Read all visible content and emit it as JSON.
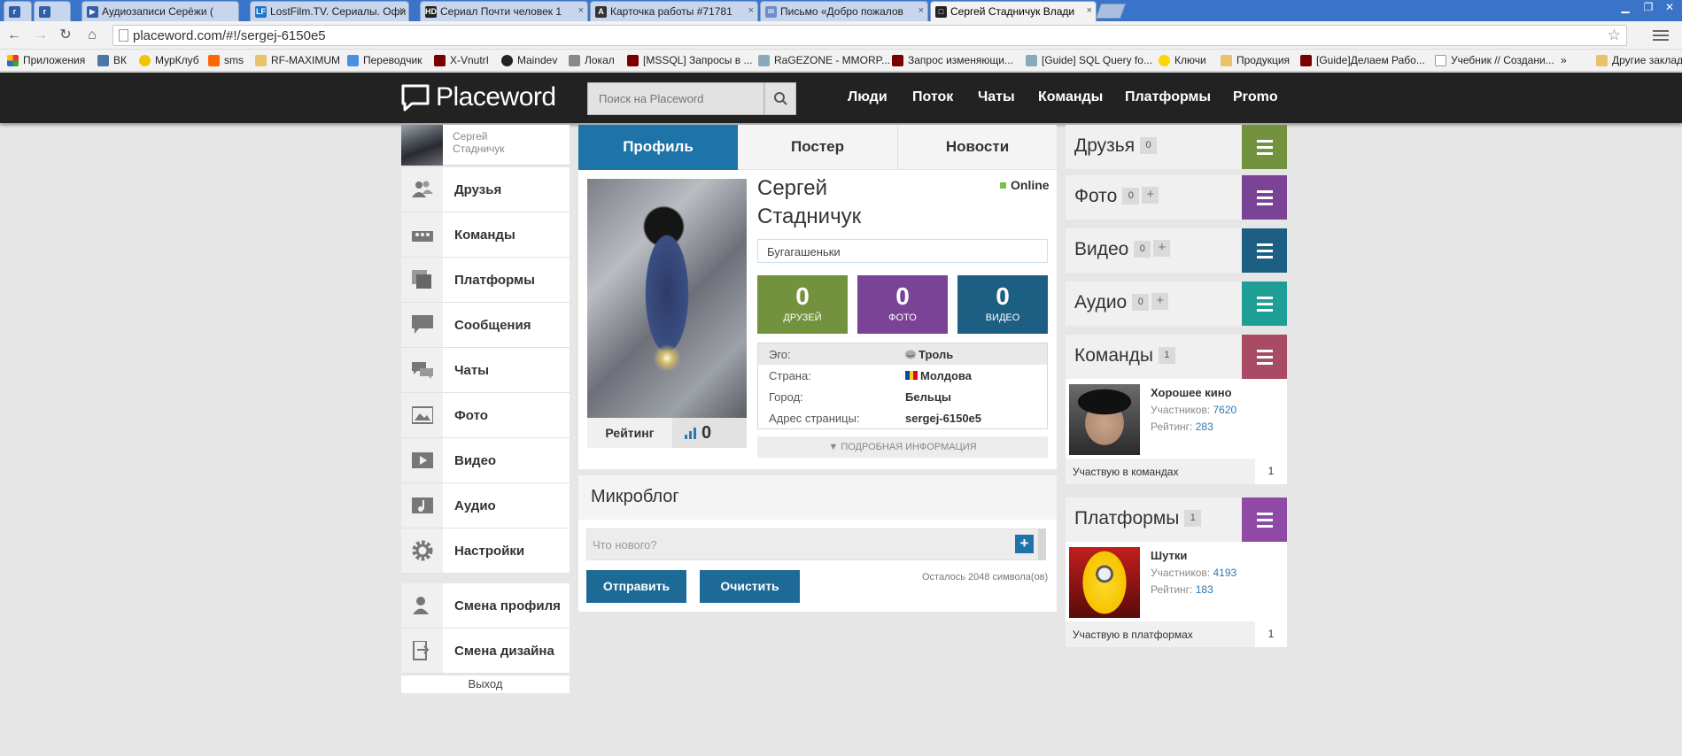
{
  "browser": {
    "tabs": [
      {
        "title": "",
        "favicon": "vk"
      },
      {
        "title": "",
        "favicon": "vk"
      },
      {
        "title": "Аудиозаписи Серёжи (",
        "favicon": "vk-audio"
      },
      {
        "title": "LostFilm.TV. Сериалы. Офи",
        "favicon": "lostfilm"
      },
      {
        "title": "Сериал Почти человек 1",
        "favicon": "hd"
      },
      {
        "title": "Карточка работы #71781",
        "favicon": "a"
      },
      {
        "title": "Письмо «Добро пожалов",
        "favicon": "mail"
      },
      {
        "title": "Сергей Стадничук Влади",
        "favicon": "placeword"
      }
    ],
    "url": "placeword.com/#!/sergej-6150e5",
    "bookmarks": [
      {
        "label": "Приложения",
        "icon": "apps-icon"
      },
      {
        "label": "ВК",
        "icon": "vk-icon"
      },
      {
        "label": "МурКлуб",
        "icon": "cat-icon"
      },
      {
        "label": "sms",
        "icon": "orange-icon"
      },
      {
        "label": "RF-MAXIMUM",
        "icon": "folder-icon"
      },
      {
        "label": "Переводчик",
        "icon": "translate-icon"
      },
      {
        "label": "X-VnutrI",
        "icon": "forum-icon"
      },
      {
        "label": "Maindev",
        "icon": "maindev-icon"
      },
      {
        "label": "Локал",
        "icon": "tools-icon"
      },
      {
        "label": "[MSSQL] Запросы в ...",
        "icon": "forum-icon"
      },
      {
        "label": "RaGEZONE - MMORP...",
        "icon": "ragezone-icon"
      },
      {
        "label": "Запрос изменяющи...",
        "icon": "forum-icon"
      },
      {
        "label": "[Guide] SQL Query fo...",
        "icon": "ragezone-icon"
      },
      {
        "label": "Ключи",
        "icon": "smile-icon"
      },
      {
        "label": "Продукция",
        "icon": "folder-icon"
      },
      {
        "label": "[Guide]Делаем Рабо...",
        "icon": "forum-icon"
      },
      {
        "label": "Учебник // Создани...",
        "icon": "page-icon"
      },
      {
        "label": "»",
        "icon": ""
      },
      {
        "label": "Другие заклад",
        "icon": "folder-icon"
      }
    ]
  },
  "site": {
    "logo": "Placeword",
    "search_placeholder": "Поиск на Placeword",
    "nav": [
      "Люди",
      "Поток",
      "Чаты",
      "Команды",
      "Платформы",
      "Promo"
    ]
  },
  "sidebar": {
    "user_name": "Сергей Стадничук",
    "items": [
      {
        "label": "Друзья",
        "icon": "friends-icon"
      },
      {
        "label": "Команды",
        "icon": "teams-icon"
      },
      {
        "label": "Платформы",
        "icon": "platforms-icon"
      },
      {
        "label": "Сообщения",
        "icon": "messages-icon"
      },
      {
        "label": "Чаты",
        "icon": "chats-icon"
      },
      {
        "label": "Фото",
        "icon": "photo-icon"
      },
      {
        "label": "Видео",
        "icon": "video-icon"
      },
      {
        "label": "Аудио",
        "icon": "audio-icon"
      },
      {
        "label": "Настройки",
        "icon": "settings-icon"
      }
    ],
    "items2": [
      {
        "label": "Смена профиля",
        "icon": "switch-profile-icon"
      },
      {
        "label": "Смена дизайна",
        "icon": "switch-design-icon"
      }
    ],
    "logout": "Выход"
  },
  "profile": {
    "tabs": [
      "Профиль",
      "Постер",
      "Новости"
    ],
    "first_name": "Сергей",
    "last_name": "Стадничук",
    "online": "Online",
    "status": "Бугагашеньки",
    "rating_label": "Рейтинг",
    "rating_value": "0",
    "stats": [
      {
        "value": "0",
        "caption": "ДРУЗЕЙ",
        "color": "#72923e"
      },
      {
        "value": "0",
        "caption": "ФОТО",
        "color": "#7b4395"
      },
      {
        "value": "0",
        "caption": "ВИДЕО",
        "color": "#1d5f82"
      }
    ],
    "info": [
      {
        "key": "Эго:",
        "value": "Троль"
      },
      {
        "key": "Страна:",
        "value": "Молдова"
      },
      {
        "key": "Город:",
        "value": "Бельцы"
      },
      {
        "key": "Адрес страницы:",
        "value": "sergej-6150e5"
      }
    ],
    "more": "ПОДРОБНАЯ ИНФОРМАЦИЯ"
  },
  "microblog": {
    "title": "Микроблог",
    "placeholder": "Что нового?",
    "send": "Отправить",
    "clear": "Очистить",
    "remaining": "Осталось 2048 символа(ов)"
  },
  "right": {
    "friends": {
      "title": "Друзья",
      "count": "0",
      "color": "#72923e"
    },
    "photo": {
      "title": "Фото",
      "count": "0",
      "color": "#7b4395"
    },
    "video": {
      "title": "Видео",
      "count": "0",
      "color": "#1d5f82"
    },
    "audio": {
      "title": "Аудио",
      "count": "0",
      "color": "#1f9e96"
    },
    "teams": {
      "title": "Команды",
      "count": "1",
      "color": "#a94b65",
      "item": {
        "name": "Хорошее кино",
        "members_label": "Участников:",
        "members": "7620",
        "rating_label": "Рейтинг:",
        "rating": "283"
      },
      "footer": "Участвую в командах",
      "footer_count": "1"
    },
    "platforms": {
      "title": "Платформы",
      "count": "1",
      "color": "#8e4aa6",
      "item": {
        "name": "Шутки",
        "members_label": "Участников:",
        "members": "4193",
        "rating_label": "Рейтинг:",
        "rating": "183"
      },
      "footer": "Участвую в платформах",
      "footer_count": "1"
    }
  }
}
